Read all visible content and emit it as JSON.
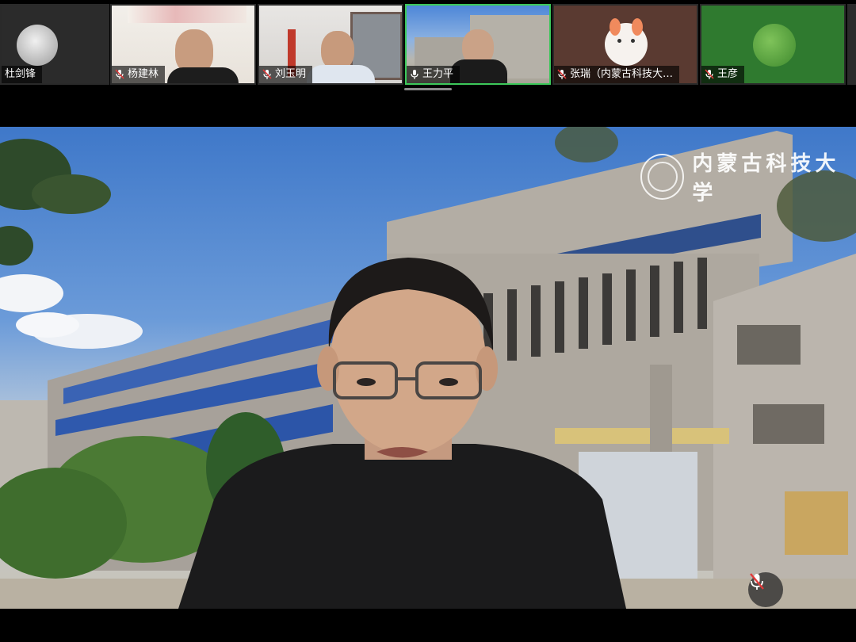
{
  "participants": [
    {
      "name": "杜剑锋",
      "mic": "none"
    },
    {
      "name": "杨建林",
      "mic": "muted"
    },
    {
      "name": "刘玉明",
      "mic": "muted"
    },
    {
      "name": "王力平",
      "mic": "on"
    },
    {
      "name": "张瑞（内蒙古科技大…",
      "mic": "muted"
    },
    {
      "name": "王彦",
      "mic": "muted"
    }
  ],
  "main_video": {
    "logo_text": "内蒙古科技大学",
    "mic_status": "muted"
  },
  "colors": {
    "active_speaker_border": "#3cc85a",
    "muted_icon": "#e23a3a"
  },
  "icons": {
    "muted": "mic-muted-icon",
    "on": "mic-icon"
  }
}
